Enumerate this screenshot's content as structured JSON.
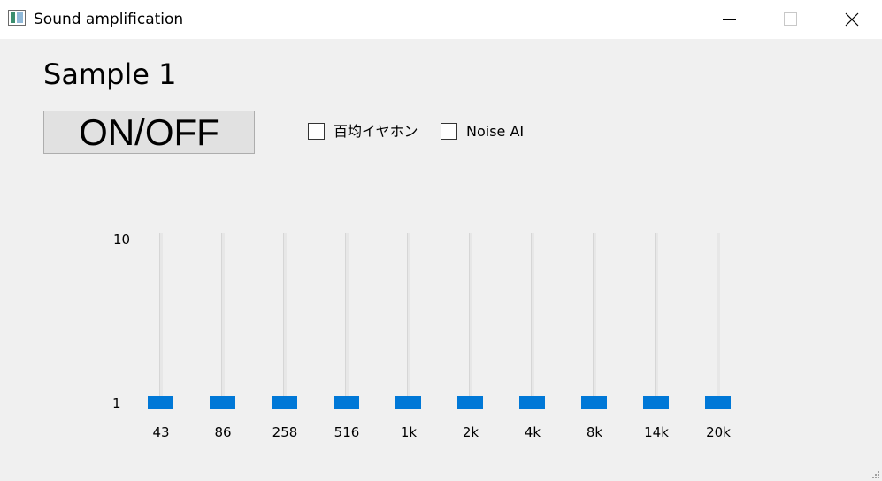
{
  "window": {
    "title": "Sound amplification",
    "icon": "app-window-icon",
    "controls": [
      "minimize-icon",
      "maximize-icon",
      "close-icon"
    ]
  },
  "heading": "Sample 1",
  "toggle": {
    "label": "ON/OFF"
  },
  "options": [
    {
      "label": "百均イヤホン",
      "checked": false
    },
    {
      "label": "Noise AI",
      "checked": false
    }
  ],
  "equalizer": {
    "scale_max_label": "10",
    "scale_min_label": "1",
    "range": [
      1,
      10
    ],
    "accent_color": "#0078d7",
    "bands": [
      {
        "label": "43",
        "value": 1
      },
      {
        "label": "86",
        "value": 1
      },
      {
        "label": "258",
        "value": 1
      },
      {
        "label": "516",
        "value": 1
      },
      {
        "label": "1k",
        "value": 1
      },
      {
        "label": "2k",
        "value": 1
      },
      {
        "label": "4k",
        "value": 1
      },
      {
        "label": "8k",
        "value": 1
      },
      {
        "label": "14k",
        "value": 1
      },
      {
        "label": "20k",
        "value": 1
      }
    ]
  }
}
